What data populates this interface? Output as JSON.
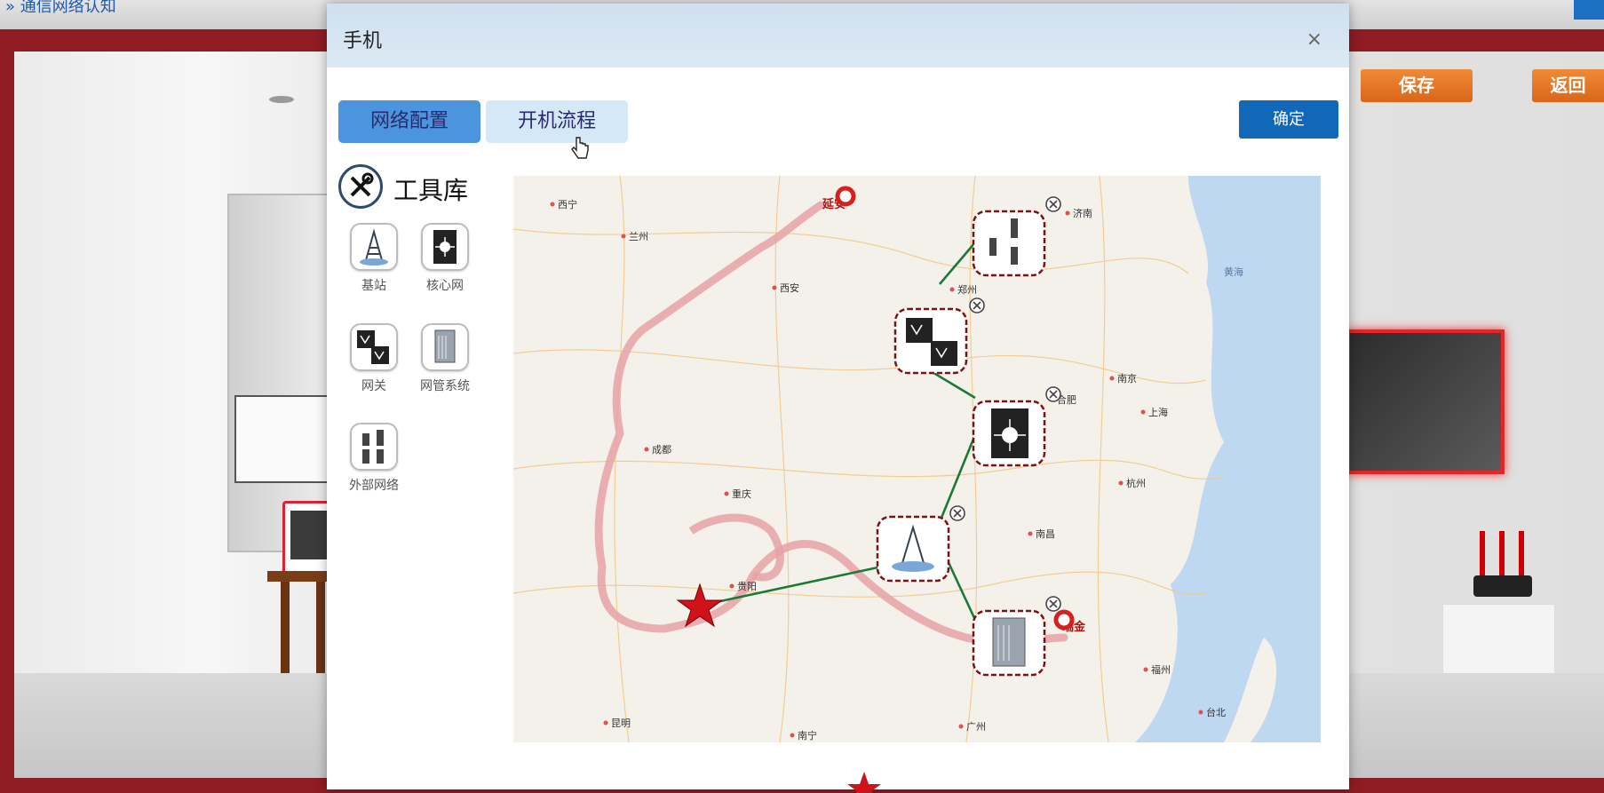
{
  "topbar": {
    "breadcrumb": "» 通信网络认知"
  },
  "scene": {
    "save_label": "保存",
    "back_label": "返回"
  },
  "modal": {
    "title": "手机",
    "close_symbol": "×",
    "tabs": [
      {
        "label": "网络配置",
        "active": true
      },
      {
        "label": "开机流程",
        "active": false
      }
    ],
    "confirm_label": "确定"
  },
  "toolbox": {
    "title": "工具库",
    "items": [
      {
        "label": "基站",
        "icon": "base-station-icon"
      },
      {
        "label": "核心网",
        "icon": "core-network-icon"
      },
      {
        "label": "网关",
        "icon": "gateway-icon"
      },
      {
        "label": "网管系统",
        "icon": "nms-server-icon"
      },
      {
        "label": "外部网络",
        "icon": "external-network-icon"
      }
    ]
  },
  "map": {
    "cities": [
      "西宁",
      "兰州",
      "延安",
      "济南",
      "西安",
      "郑州",
      "黄海",
      "合肥",
      "南京",
      "上海",
      "成都",
      "重庆",
      "杭州",
      "南昌",
      "贵阳",
      "福州",
      "瑞金",
      "昆明",
      "台北",
      "广州",
      "南宁"
    ],
    "route_color": "#e6a2a6",
    "link_color": "#1a7a35"
  },
  "colors": {
    "accent": "#4b95de",
    "confirm": "#1167b8",
    "scene_button": "#e2752a"
  }
}
